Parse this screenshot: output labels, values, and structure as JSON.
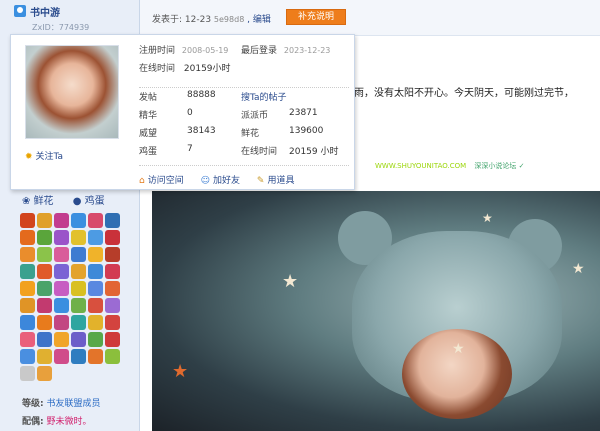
{
  "sidebar": {
    "username": "书中游",
    "zxid": "ZxID：774939",
    "links": [
      "鲜花",
      "鸡蛋"
    ],
    "emblem_colors": [
      "#d2441d",
      "#e0a02b",
      "#c23d8f",
      "#3b8fe0",
      "#d84a6b",
      "#2f6fb3",
      "#e46a1d",
      "#5aa53b",
      "#9a54c9",
      "#e2c12d",
      "#4d9be3",
      "#c9313a",
      "#ea8d2c",
      "#8bc34a",
      "#d95d9a",
      "#3e7bd1",
      "#f0b32a",
      "#b63d2a",
      "#3aa18f",
      "#e05a2a",
      "#7a63d4",
      "#e3a32c",
      "#3e89d8",
      "#d23b52",
      "#f2a11f",
      "#4aa36a",
      "#c75dc2",
      "#d9c021",
      "#5a88e0",
      "#e26534",
      "#e09426",
      "#c23a6f",
      "#3b8fe0",
      "#6fb04a",
      "#d8503e",
      "#9b6bd3",
      "#3c87db",
      "#e87b1c",
      "#c24682",
      "#2fa5a0",
      "#e2b22b",
      "#d3433f",
      "#e95f7b",
      "#3e74c9",
      "#f0a52a",
      "#6c5ec9",
      "#58a84a",
      "#cf3a3a",
      "#4a8fe0",
      "#e0b030",
      "#d04c8a",
      "#2f7dc0",
      "#e3742a",
      "#8bbf3c",
      "#c9c9c9",
      "#e8a03c"
    ],
    "level_label": "等级:",
    "level_value": "书友联盟成员",
    "match_label": "配偶:",
    "match_value": "野未微时。"
  },
  "topbar": {
    "post_prefix": "发表于: 12-23",
    "hash": "5e98d8",
    "edit": ", 编辑",
    "add_button": "补充说明"
  },
  "content": {
    "post_text": "雨，没有太阳不开心。今天阴天，可能刚过完节，",
    "watermark_site": "WWW.SHUYOUNITAO.COM",
    "watermark_text": "深深小说论坛 ✓"
  },
  "popup": {
    "reg_label": "注册时间",
    "reg_value": "2008-05-19",
    "last_label": "最后登录",
    "last_value": "2023-12-23",
    "online_label": "在线时间",
    "online_value": "20159小时",
    "follow_label": "关注Ta",
    "search_posts": "搜Ta的帖子",
    "stats": [
      {
        "label": "发帖",
        "value": "88888"
      },
      {
        "label": "派派币",
        "value": "23871"
      },
      {
        "label": "精华",
        "value": "0"
      },
      {
        "label": "威望",
        "value": "38143"
      },
      {
        "label": "鲜花",
        "value": "139600"
      },
      {
        "label": "鸡蛋",
        "value": "7"
      },
      {
        "label": "在线时间",
        "value": "20159 小时"
      }
    ],
    "actions": [
      "访问空间",
      "加好友",
      "用道具"
    ]
  }
}
